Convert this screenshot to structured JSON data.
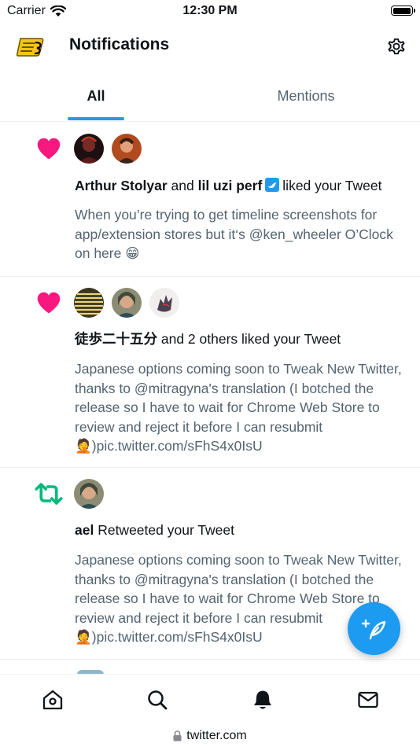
{
  "status_bar": {
    "carrier": "Carrier",
    "time": "12:30 PM"
  },
  "header": {
    "title": "Notifications",
    "logo_icon": "tweak-new-twitter-logo",
    "settings_icon": "gear-icon"
  },
  "tabs": [
    {
      "label": "All",
      "selected": true
    },
    {
      "label": "Mentions",
      "selected": false
    }
  ],
  "notifications": [
    {
      "kind": "like",
      "actors": [
        "Arthur Stolyar",
        "lil uzi perf"
      ],
      "connector": "and",
      "verified": true,
      "action": "liked your Tweet",
      "text": "When you’re trying to get timeline screenshots for app/extension stores but it‘s @ken_wheeler O’Clock on here 😁"
    },
    {
      "kind": "like",
      "actors": [
        "徒歩二十五分"
      ],
      "action": "and 2 others liked your Tweet",
      "text": "Japanese options coming soon to Tweak New Twitter, thanks to @mitragyna's translation (I botched the release so I have to wait for Chrome Web Store to review and reject it before I can resubmit 🤦)pic.twitter.com/sFhS4x0IsU"
    },
    {
      "kind": "retweet",
      "actors": [
        "ael"
      ],
      "action": "Retweeted your Tweet",
      "text": "Japanese options coming soon to Tweak New Twitter, thanks to @mitragyna's translation (I botched the release so I have to wait for Chrome Web Store to review and reject it before I can resubmit 🤦)pic.twitter.com/sFhS4x0IsU"
    }
  ],
  "fab": {
    "icon": "compose-tweet-icon"
  },
  "bottom_nav": [
    {
      "name": "home",
      "icon": "home-icon"
    },
    {
      "name": "search",
      "icon": "search-icon"
    },
    {
      "name": "notifications",
      "icon": "bell-icon",
      "active": true
    },
    {
      "name": "messages",
      "icon": "mail-icon"
    }
  ],
  "url_bar": {
    "domain": "twitter.com"
  },
  "colors": {
    "accent": "#1d9bf0",
    "like": "#f91880",
    "retweet": "#00ba7c",
    "secondary_text": "#536471"
  }
}
